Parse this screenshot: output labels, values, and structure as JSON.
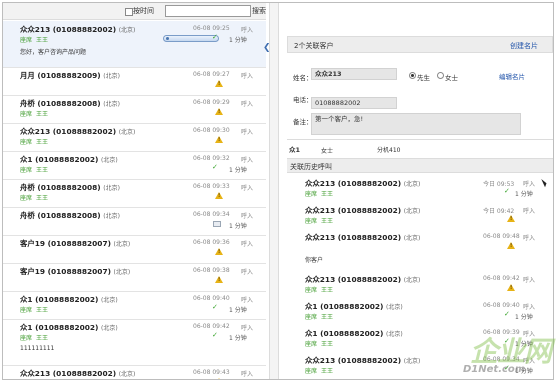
{
  "toolbar": {
    "time_label": "按时间",
    "search_button": "搜索"
  },
  "left_list": [
    {
      "name": "众众213 (01088882002)",
      "loc": "(北京)",
      "time": "06-08 09:25",
      "dir": "呼入",
      "tag": "座席",
      "agent": "王王",
      "status": "1 分钟",
      "icon": "check",
      "player": true,
      "extra": "您好，客户咨询产品问题"
    },
    {
      "name": "月月 (01088882009)",
      "loc": "(北京)",
      "time": "06-08 09:27",
      "dir": "呼入",
      "tag": "",
      "agent": "",
      "status": "",
      "icon": "warning"
    },
    {
      "name": "舟桥 (01088882008)",
      "loc": "(北京)",
      "time": "06-08 09:29",
      "dir": "呼入",
      "tag": "座席",
      "agent": "王王",
      "status": "",
      "icon": "warning"
    },
    {
      "name": "众众213 (01088882002)",
      "loc": "(北京)",
      "time": "06-08 09:30",
      "dir": "呼入",
      "tag": "座席",
      "agent": "王王",
      "status": "",
      "icon": "warning"
    },
    {
      "name": "众1 (01088882002)",
      "loc": "(北京)",
      "time": "06-08 09:32",
      "dir": "呼入",
      "tag": "座席",
      "agent": "王王",
      "status": "1 分钟",
      "icon": "check"
    },
    {
      "name": "舟桥 (01088882008)",
      "loc": "(北京)",
      "time": "06-08 09:33",
      "dir": "呼入",
      "tag": "座席",
      "agent": "王王",
      "status": "",
      "icon": "warning"
    },
    {
      "name": "舟桥 (01088882008)",
      "loc": "(北京)",
      "time": "06-08 09:34",
      "dir": "呼入",
      "tag": "",
      "agent": "",
      "status": "1 分钟",
      "icon": "mail"
    },
    {
      "name": "客户19 (01088882007)",
      "loc": "(北京)",
      "time": "06-08 09:36",
      "dir": "呼入",
      "tag": "",
      "agent": "",
      "status": "",
      "icon": "warning"
    },
    {
      "name": "客户19 (01088882007)",
      "loc": "(北京)",
      "time": "06-08 09:38",
      "dir": "呼入",
      "tag": "",
      "agent": "",
      "status": "",
      "icon": "warning"
    },
    {
      "name": "众1 (01088882002)",
      "loc": "(北京)",
      "time": "06-08 09:40",
      "dir": "呼入",
      "tag": "座席",
      "agent": "王王",
      "status": "1 分钟",
      "icon": "check"
    },
    {
      "name": "众1 (01088882002)",
      "loc": "(北京)",
      "time": "06-08 09:42",
      "dir": "呼入",
      "tag": "座席",
      "agent": "王王",
      "status": "1 分钟",
      "icon": "check",
      "extra": "111111111"
    },
    {
      "name": "众众213 (01088882002)",
      "loc": "(北京)",
      "time": "06-08 09:43",
      "dir": "呼入",
      "tag": "",
      "agent": "",
      "status": "",
      "icon": "warning"
    }
  ],
  "right_panel": {
    "header_title": "2个关联客户",
    "header_link": "创建名片",
    "name_label": "姓名：",
    "name_value": "众众213",
    "gender_male": "先生",
    "gender_female": "女士",
    "edit_link": "编辑名片",
    "phone_label": "电话：",
    "phone_value": "01088882002",
    "note_label": "备注：",
    "note_value": "第一个客户，急!",
    "contact_name": "众1",
    "contact_gender": "女士",
    "contact_ext": "分机410",
    "history_title": "关联历史呼叫"
  },
  "history": [
    {
      "name": "众众213 (01088882002)",
      "loc": "(北京)",
      "time": "今日 09:53",
      "dir": "呼入",
      "tag": "座席",
      "agent": "王王",
      "icon": "check",
      "status": "1 分钟"
    },
    {
      "name": "众众213 (01088882002)",
      "loc": "(北京)",
      "time": "今日 09:42",
      "dir": "呼入",
      "tag": "座席",
      "agent": "王王",
      "icon": "warning",
      "status": ""
    },
    {
      "name": "众众213 (01088882002)",
      "loc": "(北京)",
      "time": "06-08 09:48",
      "dir": "呼入",
      "tag": "",
      "agent": "",
      "icon": "warning",
      "status": "",
      "extra": "你客户"
    },
    {
      "name": "众众213 (01088882002)",
      "loc": "(北京)",
      "time": "06-08 09:42",
      "dir": "呼入",
      "tag": "座席",
      "agent": "王王",
      "icon": "warning",
      "status": ""
    },
    {
      "name": "众1 (01088882002)",
      "loc": "(北京)",
      "time": "06-08 09:40",
      "dir": "呼入",
      "tag": "座席",
      "agent": "王王",
      "icon": "check",
      "status": "1 分钟"
    },
    {
      "name": "众1 (01088882002)",
      "loc": "(北京)",
      "time": "06-08 09:39",
      "dir": "呼入",
      "tag": "座席",
      "agent": "王王",
      "icon": "check",
      "status": "1 分钟"
    },
    {
      "name": "众众213 (01088882002)",
      "loc": "(北京)",
      "time": "06-08 09:34",
      "dir": "呼入",
      "tag": "座席",
      "agent": "王王",
      "icon": "check",
      "status": "1 分钟"
    }
  ],
  "watermark": {
    "logo": "企业网",
    "site": "D1Net.com"
  }
}
